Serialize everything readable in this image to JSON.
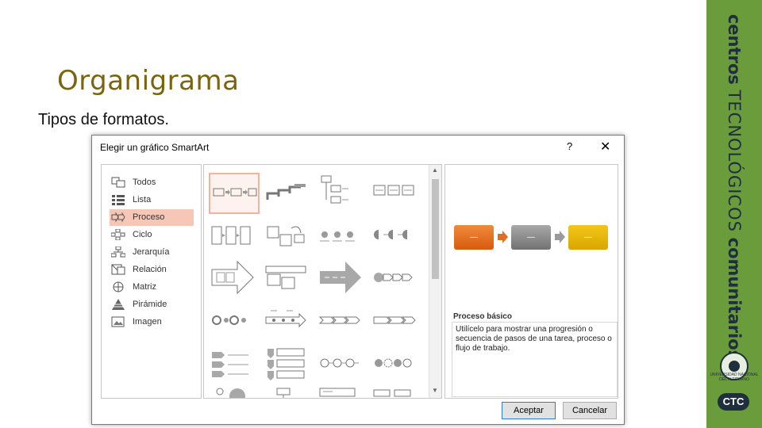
{
  "slide": {
    "title": "Organigrama",
    "subtitle": "Tipos de formatos."
  },
  "brand": {
    "word1": "centros",
    "word2": "TECNOLÓGICOS",
    "word3": "comunitarios",
    "badge": "CTC",
    "seal_text": "UNIVERSIDAD NACIONAL DEL ALTIPLANO",
    "color": "#6a9c3c"
  },
  "dialog": {
    "title": "Elegir un gráfico SmartArt",
    "help": "?",
    "close": "✕",
    "categories": [
      {
        "label": "Todos",
        "icon": "all-layouts-icon"
      },
      {
        "label": "Lista",
        "icon": "list-icon"
      },
      {
        "label": "Proceso",
        "icon": "process-icon",
        "selected": true
      },
      {
        "label": "Ciclo",
        "icon": "cycle-icon"
      },
      {
        "label": "Jerarquía",
        "icon": "hierarchy-icon"
      },
      {
        "label": "Relación",
        "icon": "relationship-icon"
      },
      {
        "label": "Matriz",
        "icon": "matrix-icon"
      },
      {
        "label": "Pirámide",
        "icon": "pyramid-icon"
      },
      {
        "label": "Imagen",
        "icon": "picture-icon"
      }
    ],
    "preview": {
      "name": "Proceso básico",
      "description": "Utilícelo para mostrar una progresión o secuencia de pasos de una tarea, proceso o flujo de trabajo.",
      "box_labels": [
        "—",
        "—",
        "—"
      ],
      "colors": [
        "#e46c1f",
        "#8b8b8b",
        "#e3b400"
      ]
    },
    "buttons": {
      "ok": "Aceptar",
      "cancel": "Cancelar"
    }
  }
}
